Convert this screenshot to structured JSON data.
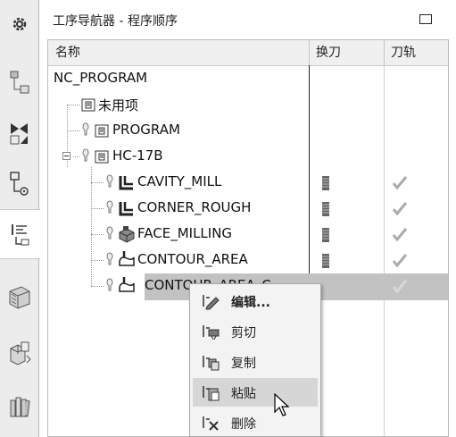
{
  "sidebar": {
    "items": [
      {
        "icon": "settings-gear-icon"
      },
      {
        "icon": "geometry-view-icon"
      },
      {
        "icon": "machine-tool-view-icon"
      },
      {
        "icon": "method-view-icon"
      },
      {
        "icon": "program-order-view-icon"
      },
      {
        "icon": "cutter-library-icon"
      },
      {
        "icon": "assembly-navigator-icon"
      },
      {
        "icon": "reuse-library-icon"
      }
    ]
  },
  "navigator": {
    "title": "工序导航器 - 程序顺序",
    "columns": [
      "名称",
      "换刀",
      "刀轨"
    ]
  },
  "tree": {
    "rows": [
      {
        "name": "NC_PROGRAM",
        "icon": "none"
      },
      {
        "name": "未用项",
        "icon": "program-group-icon"
      },
      {
        "name": "PROGRAM",
        "icon": "program-group-icon"
      },
      {
        "name": "HC-17B",
        "icon": "program-group-icon",
        "expanded": true
      },
      {
        "name": "CAVITY_MILL",
        "icon": "cavity-mill-icon",
        "tool_change": true,
        "path_ok": true
      },
      {
        "name": "CORNER_ROUGH",
        "icon": "cavity-mill-icon",
        "tool_change": true,
        "path_ok": true
      },
      {
        "name": "FACE_MILLING",
        "icon": "face-milling-icon",
        "tool_change": true,
        "path_ok": true
      },
      {
        "name": "CONTOUR_AREA",
        "icon": "contour-area-icon",
        "tool_change": true,
        "path_ok": true
      },
      {
        "name": "CONTOUR_AREA_C",
        "icon": "contour-area-icon",
        "tool_change": false,
        "path_ok": true,
        "selected": true
      }
    ]
  },
  "context_menu": {
    "items": [
      {
        "label": "编辑...",
        "icon": "edit-icon"
      },
      {
        "label": "剪切",
        "icon": "cut-icon"
      },
      {
        "label": "复制",
        "icon": "copy-icon"
      },
      {
        "label": "粘贴",
        "icon": "paste-icon",
        "hover": true
      },
      {
        "label": "删除",
        "icon": "delete-icon"
      }
    ]
  },
  "colors": {
    "selected_row": "#c2c2c2",
    "menu_hover": "#d6d6d6",
    "header_bg": "#f0f0f0"
  }
}
